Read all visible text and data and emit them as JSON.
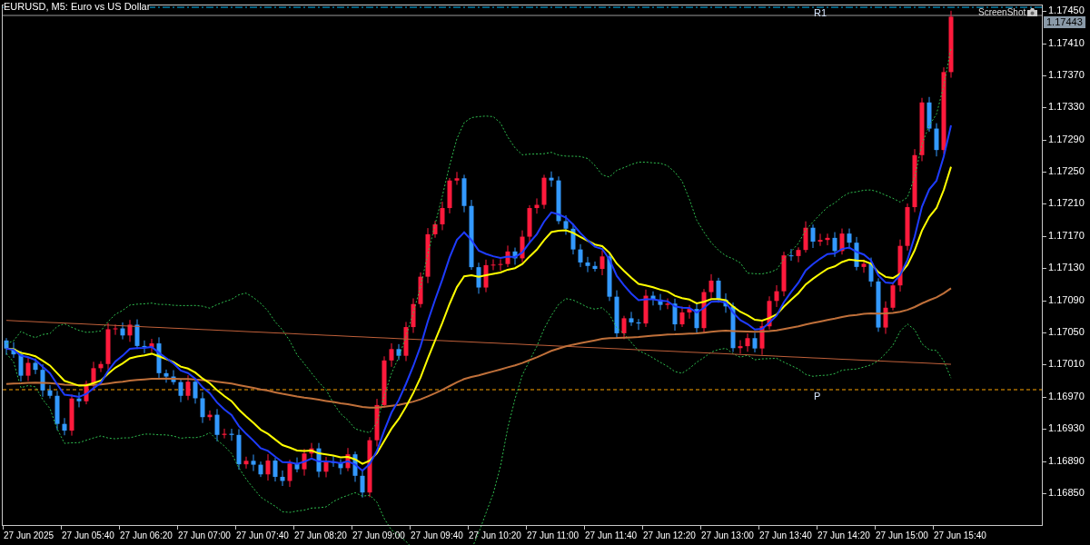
{
  "window": {
    "title": "EURUSD, M5:  Euro vs US Dollar"
  },
  "levels": [
    {
      "label": "R1",
      "kind": "pivot"
    },
    {
      "label": "P",
      "kind": "pivot"
    }
  ],
  "indicator": {
    "label": "ScreenShot"
  },
  "current_price": "1.17443",
  "price_axis": [
    "1.17450",
    "1.17410",
    "1.17370",
    "1.17330",
    "1.17290",
    "1.17250",
    "1.17210",
    "1.17170",
    "1.17130",
    "1.17090",
    "1.17050",
    "1.17010",
    "1.16970",
    "1.16930",
    "1.16890",
    "1.16850"
  ],
  "time_axis": [
    "27 Jun 2025",
    "27 Jun 05:40",
    "27 Jun 06:20",
    "27 Jun 07:00",
    "27 Jun 07:40",
    "27 Jun 08:20",
    "27 Jun 09:00",
    "27 Jun 09:40",
    "27 Jun 10:20",
    "27 Jun 11:00",
    "27 Jun 11:40",
    "27 Jun 12:20",
    "27 Jun 13:00",
    "27 Jun 13:40",
    "27 Jun 14:20",
    "27 Jun 15:00",
    "27 Jun 15:40"
  ]
}
